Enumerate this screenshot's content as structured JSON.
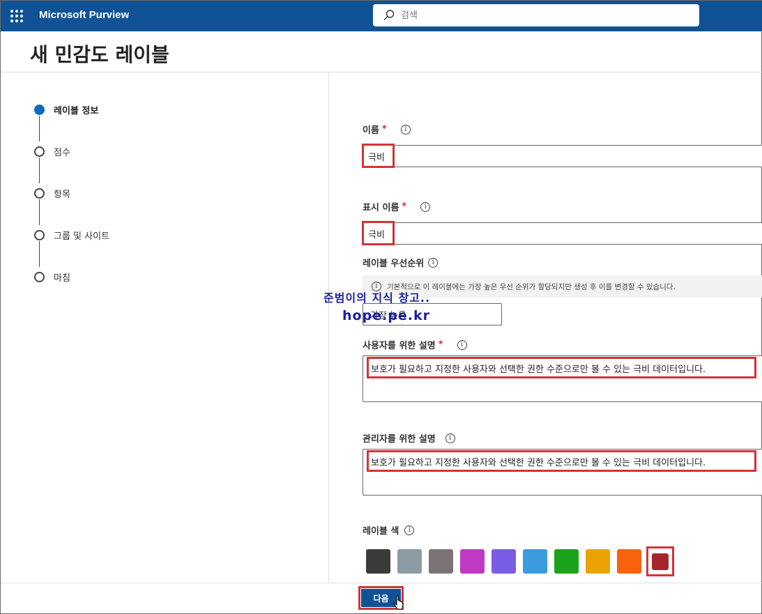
{
  "topbar": {
    "app_title": "Microsoft Purview",
    "search_placeholder": "검색"
  },
  "page_title": "새 민감도 레이블",
  "steps": [
    {
      "label": "레이블 정보",
      "active": true
    },
    {
      "label": "점수",
      "active": false
    },
    {
      "label": "항목",
      "active": false
    },
    {
      "label": "그룹 및 사이트",
      "active": false
    },
    {
      "label": "마침",
      "active": false
    }
  ],
  "form": {
    "name_label": "이름",
    "name_value": "극비",
    "display_name_label": "표시 이름",
    "display_name_value": "극비",
    "required_mark": "*",
    "priority_label": "레이블 우선순위",
    "priority_info": "기본적으로 이 레이블에는 가장 높은 우선 순위가 할당되지만 생성 후 이를 변경할 수 있습니다.",
    "priority_value": "가장 높음",
    "user_desc_label": "사용자를 위한 설명",
    "user_desc_value": "보호가 필요하고 지정한 사용자와 선택한 권한 수준으로만 볼 수 있는 극비 데이터입니다.",
    "admin_desc_label": "관리자를 위한 설명",
    "admin_desc_value": "보호가 필요하고 지정한 사용자와 선택한 권한 수준으로만 볼 수 있는 극비 데이터입니다.",
    "color_label": "레이블 색",
    "colors": [
      "#3b3b3b",
      "#8b9ba3",
      "#7c7474",
      "#c03bc4",
      "#7b5ce6",
      "#3b9be0",
      "#1ba41b",
      "#eaa300",
      "#f7630c"
    ],
    "selected_color": "#a4262c",
    "info_glyph": "i"
  },
  "watermark": {
    "line1": "준범이의 지식 창고..",
    "line2": "hope.pe.kr"
  },
  "footer": {
    "next_label": "다음"
  }
}
